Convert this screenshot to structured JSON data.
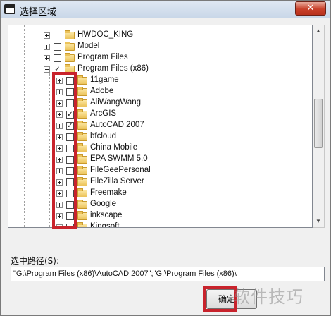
{
  "window": {
    "title": "选择区域",
    "close_glyph": "✕"
  },
  "tree": {
    "top_items": [
      {
        "label": "HWDOC_KING",
        "checked": false,
        "expanded": false
      },
      {
        "label": "Model",
        "checked": false,
        "expanded": false
      },
      {
        "label": "Program Files",
        "checked": false,
        "expanded": false
      },
      {
        "label": "Program Files (x86)",
        "checked": true,
        "expanded": true
      }
    ],
    "children": [
      {
        "label": "11game",
        "checked": false
      },
      {
        "label": "Adobe",
        "checked": false
      },
      {
        "label": "AliWangWang",
        "checked": false
      },
      {
        "label": "ArcGIS",
        "checked": true
      },
      {
        "label": "AutoCAD 2007",
        "checked": true
      },
      {
        "label": "bfcloud",
        "checked": false
      },
      {
        "label": "China Mobile",
        "checked": false
      },
      {
        "label": "EPA SWMM 5.0",
        "checked": false
      },
      {
        "label": "FileGeePersonal",
        "checked": false
      },
      {
        "label": "FileZilla Server",
        "checked": false
      },
      {
        "label": "Freemake",
        "checked": false
      },
      {
        "label": "Google",
        "checked": false
      },
      {
        "label": "inkscape",
        "checked": false
      },
      {
        "label": "Kingsoft",
        "checked": false
      }
    ]
  },
  "path": {
    "label": "选中路径(S):",
    "value": "\"G:\\Program Files (x86)\\AutoCAD 2007\";\"G:\\Program Files (x86)\\"
  },
  "buttons": {
    "ok_label": "确定"
  },
  "watermark": "软件技巧",
  "colors": {
    "highlight": "#c8232c",
    "title_gradient": "#c9d7e8",
    "close_button": "#c8402a"
  },
  "icons": [
    "app-icon",
    "close-icon",
    "folder-icon",
    "expand-icon",
    "collapse-icon",
    "checkbox-icon"
  ]
}
